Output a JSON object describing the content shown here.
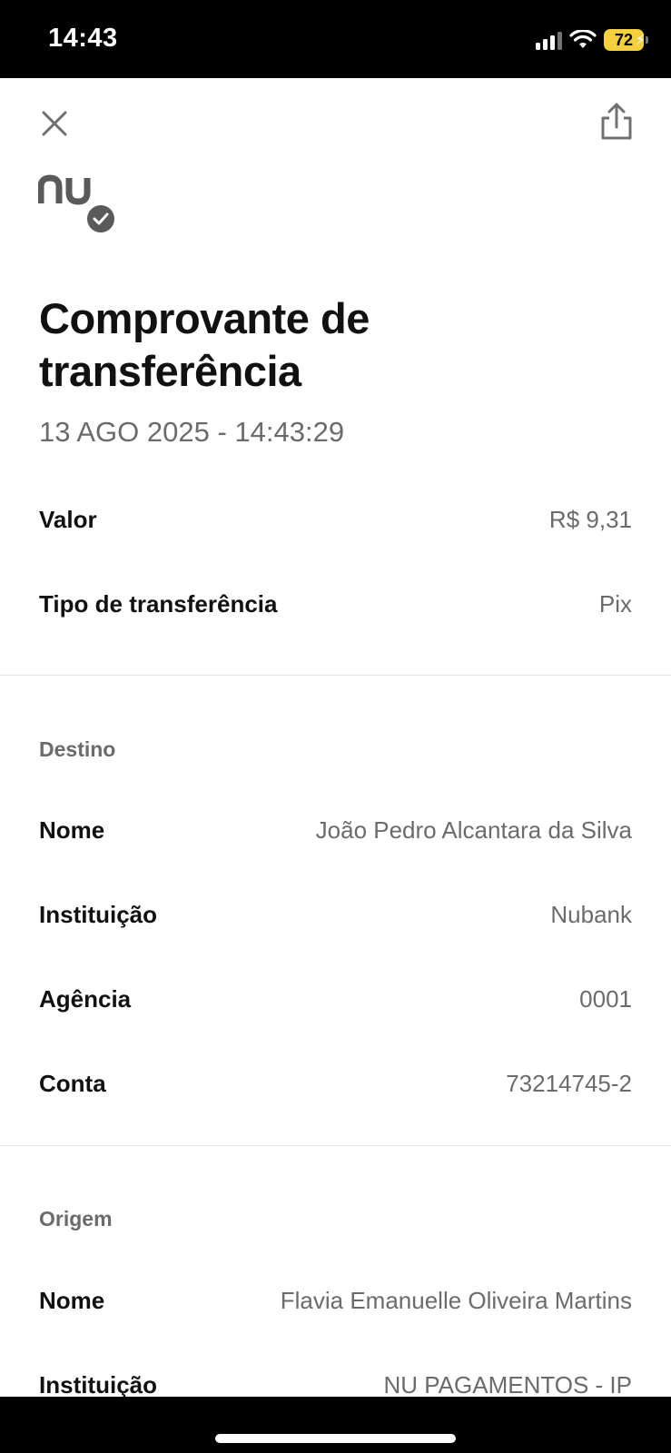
{
  "status_bar": {
    "time": "14:43",
    "battery": "72",
    "icons": [
      "signal-icon",
      "wifi-icon",
      "battery-icon",
      "charging-bolt-icon"
    ]
  },
  "header": {
    "close_icon": "close-icon",
    "share_icon": "share-icon",
    "logo_icon": "nu-logo-verified-icon"
  },
  "receipt": {
    "title": "Comprovante de transferência",
    "datetime": "13 AGO 2025 - 14:43:29",
    "summary": [
      {
        "label": "Valor",
        "value": "R$ 9,31"
      },
      {
        "label": "Tipo de transferência",
        "value": "Pix"
      }
    ],
    "destination": {
      "title": "Destino",
      "rows": [
        {
          "label": "Nome",
          "value": "João Pedro Alcantara da Silva"
        },
        {
          "label": "Instituição",
          "value": "Nubank"
        },
        {
          "label": "Agência",
          "value": "0001"
        },
        {
          "label": "Conta",
          "value": "73214745-2"
        }
      ]
    },
    "origin": {
      "title": "Origem",
      "rows": [
        {
          "label": "Nome",
          "value": "Flavia Emanuelle Oliveira Martins"
        },
        {
          "label": "Instituição",
          "value": "NU PAGAMENTOS - IP"
        }
      ]
    }
  },
  "colors": {
    "background": "#ffffff",
    "text_primary": "#111111",
    "text_secondary": "#6b6b6b",
    "icon_gray": "#707070",
    "battery": "#f4d03f"
  }
}
